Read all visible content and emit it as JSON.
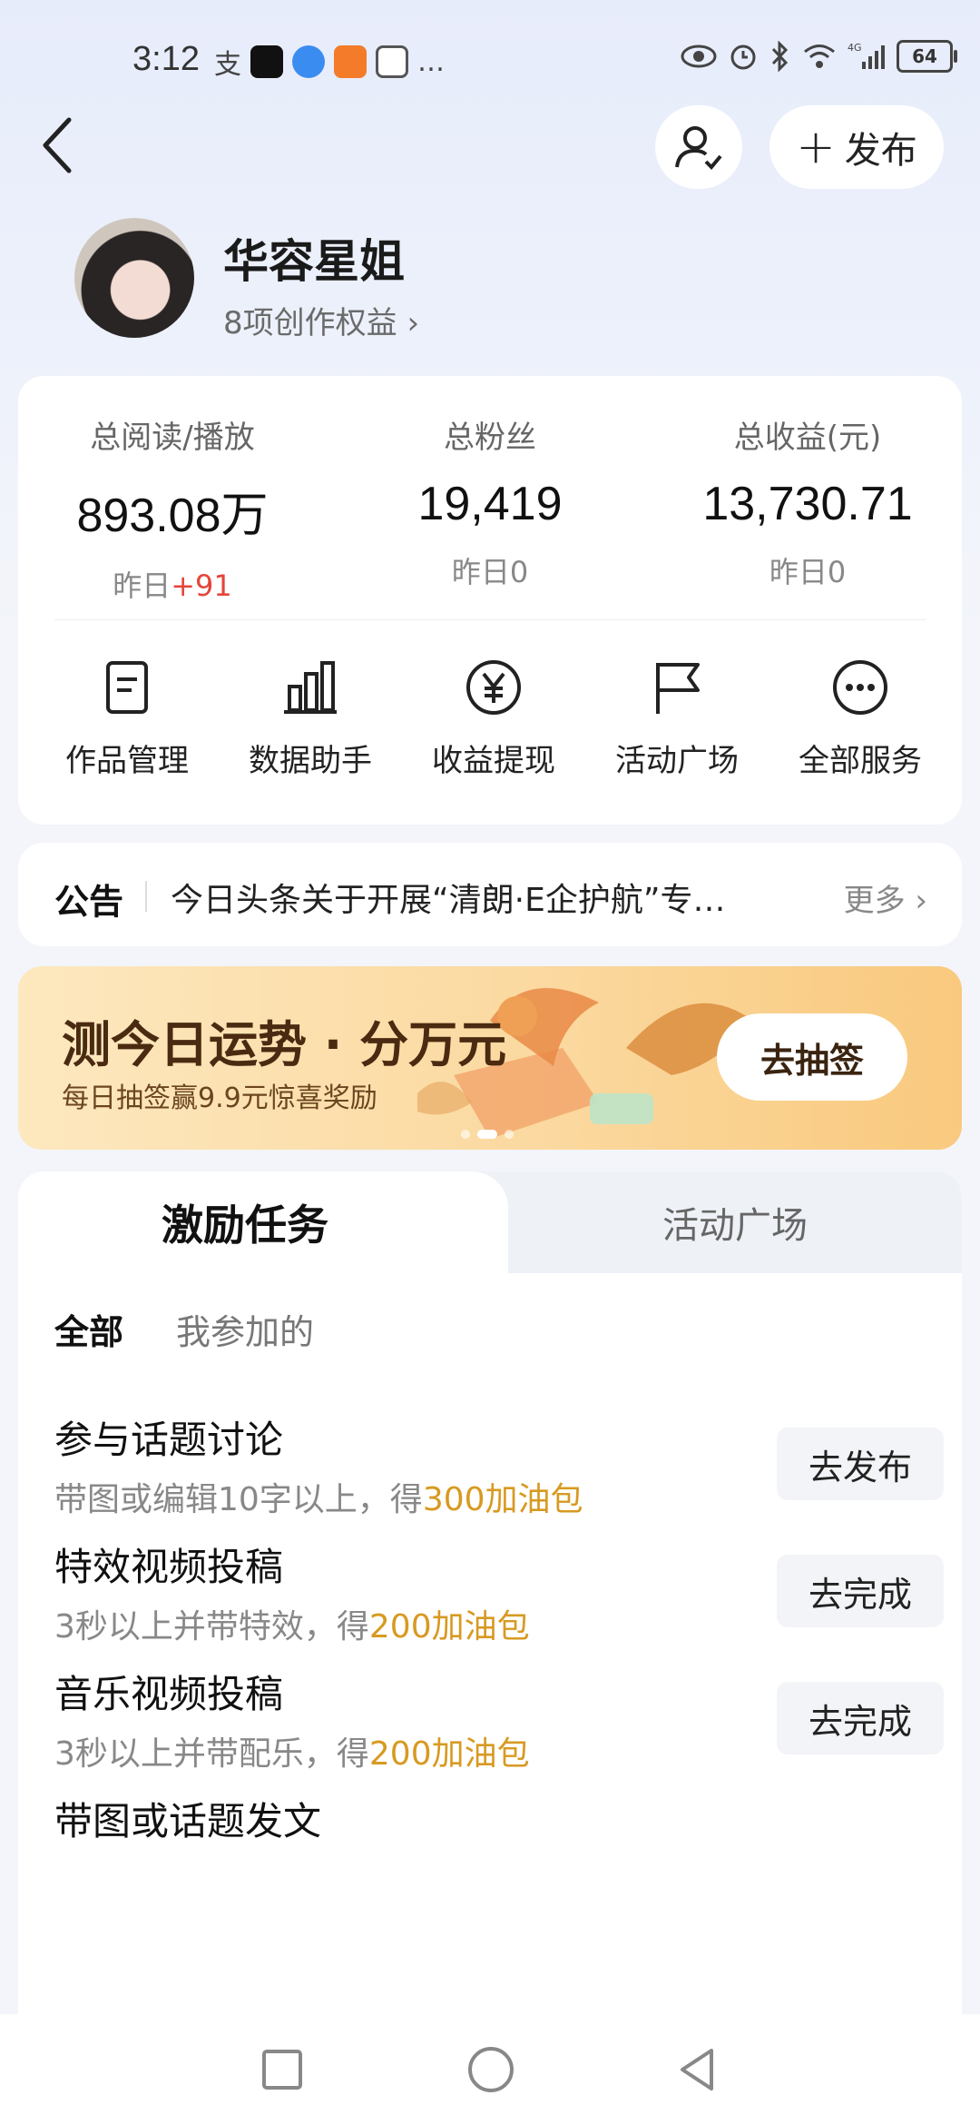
{
  "status_bar": {
    "time": "3:12",
    "left_glyphs": [
      "支",
      "…"
    ],
    "battery": "64",
    "network": "4G"
  },
  "header": {
    "publish_label": "发布"
  },
  "profile": {
    "name": "华容星姐",
    "rights": "8项创作权益 ›"
  },
  "stats": [
    {
      "label": "总阅读/播放",
      "value": "893.08万",
      "yday_prefix": "昨日",
      "yday_value": "+91"
    },
    {
      "label": "总粉丝",
      "value": "19,419",
      "yday_prefix": "昨日",
      "yday_value": "0"
    },
    {
      "label": "总收益(元)",
      "value": "13,730.71",
      "yday_prefix": "昨日",
      "yday_value": "0"
    }
  ],
  "services": [
    {
      "label": "作品管理",
      "icon": "document-icon"
    },
    {
      "label": "数据助手",
      "icon": "bar-chart-icon"
    },
    {
      "label": "收益提现",
      "icon": "yen-icon"
    },
    {
      "label": "活动广场",
      "icon": "flag-icon"
    },
    {
      "label": "全部服务",
      "icon": "more-icon"
    }
  ],
  "notice": {
    "tag": "公告",
    "text": "今日头条关于开展“清朗·E企护航”专…",
    "more": "更多 ›"
  },
  "banner": {
    "title": "测今日运势 · 分万元",
    "subtitle": "每日抽签赢9.9元惊喜奖励",
    "button": "去抽签",
    "colors": {
      "start": "#fde8bf",
      "end": "#f9c97e"
    }
  },
  "tasks": {
    "tabs": [
      "激励任务",
      "活动广场"
    ],
    "filters": [
      "全部",
      "我参加的"
    ],
    "items": [
      {
        "title": "参与话题讨论",
        "desc_prefix": "带图或编辑10字以上，得",
        "reward": "300加油包",
        "button": "去发布"
      },
      {
        "title": "特效视频投稿",
        "desc_prefix": "3秒以上并带特效，得",
        "reward": "200加油包",
        "button": "去完成"
      },
      {
        "title": "音乐视频投稿",
        "desc_prefix": "3秒以上并带配乐，得",
        "reward": "200加油包",
        "button": "去完成"
      },
      {
        "title": "带图或话题发文",
        "desc_prefix": "",
        "reward": "",
        "button": ""
      }
    ]
  },
  "accent_colors": {
    "reward": "#d79a21",
    "increase": "#e5453a"
  }
}
